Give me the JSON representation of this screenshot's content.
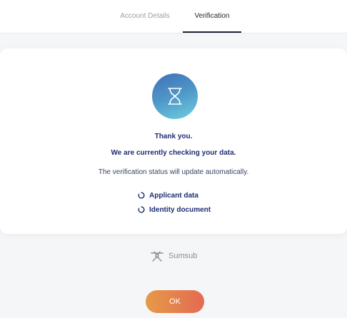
{
  "tabs": [
    {
      "label": "Account Details",
      "active": false
    },
    {
      "label": "Verification",
      "active": true
    }
  ],
  "status_card": {
    "icon": "hourglass-icon",
    "thanks_text": "Thank you.",
    "checking_text": "We are currently checking your data.",
    "status_text": "The verification status will update automatically.",
    "items": [
      {
        "label": "Applicant data",
        "icon": "spinner-icon"
      },
      {
        "label": "Identity document",
        "icon": "spinner-icon"
      }
    ]
  },
  "footer": {
    "brand_icon": "sumsub-logo-icon",
    "brand_label": "Sumsub",
    "ok_label": "OK"
  },
  "colors": {
    "accent_text": "#1d2c73",
    "icon_gradient_start": "#3f6fb7",
    "icon_gradient_end": "#6fd0df",
    "button_gradient_start": "#e69a48",
    "button_gradient_end": "#e36a52"
  }
}
